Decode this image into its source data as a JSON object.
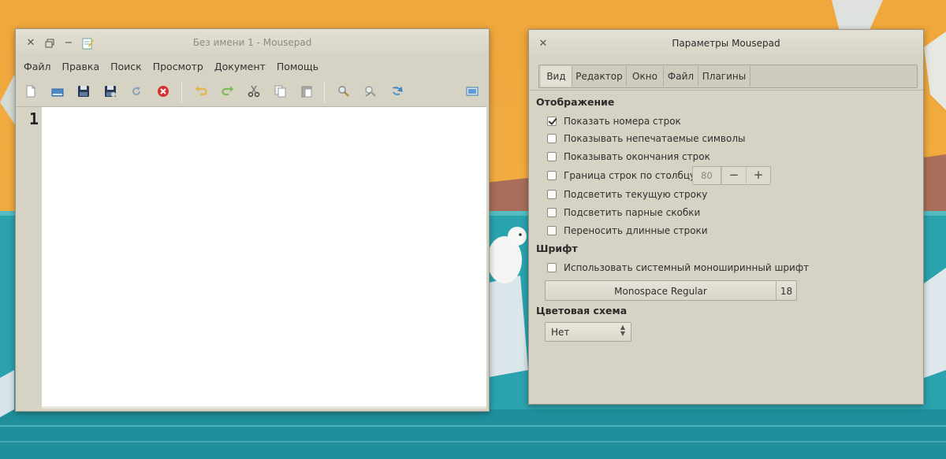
{
  "mousepad": {
    "title": "Без имени 1 - Mousepad",
    "menus": [
      "Файл",
      "Правка",
      "Поиск",
      "Просмотр",
      "Документ",
      "Помощь"
    ],
    "toolbar_icons": [
      "new-document-icon",
      "open-file-icon",
      "save-icon",
      "save-as-icon",
      "reload-icon",
      "close-icon",
      "undo-icon",
      "redo-icon",
      "cut-icon",
      "copy-icon",
      "paste-icon",
      "find-icon",
      "find-replace-icon",
      "go-to-icon",
      "fullscreen-icon"
    ],
    "line_number": "1"
  },
  "prefs": {
    "title": "Параметры Mousepad",
    "tabs": [
      "Вид",
      "Редактор",
      "Окно",
      "Файл",
      "Плагины"
    ],
    "active_tab": "Вид",
    "section_display": "Отображение",
    "options": [
      {
        "label": "Показать номера строк",
        "checked": true
      },
      {
        "label": "Показывать непечатаемые символы",
        "checked": false
      },
      {
        "label": "Показывать окончания строк",
        "checked": false
      },
      {
        "label": "Граница строк по столбцу:",
        "checked": false
      },
      {
        "label": "Подсветить текущую строку",
        "checked": false
      },
      {
        "label": "Подсветить парные скобки",
        "checked": false
      },
      {
        "label": "Переносить длинные строки",
        "checked": false
      }
    ],
    "margin_column": "80",
    "spin_minus": "−",
    "spin_plus": "+",
    "section_font": "Шрифт",
    "use_system_font": {
      "label": "Использовать системный моноширинный шрифт",
      "checked": false
    },
    "font_name": "Monospace Regular",
    "font_size": "18",
    "section_color": "Цветовая схема",
    "color_scheme": "Нет"
  },
  "colors": {
    "window_bg": "#d6d2c4",
    "wallpaper_sky": "#f0a73c",
    "wallpaper_sea": "#2ba6b0"
  }
}
